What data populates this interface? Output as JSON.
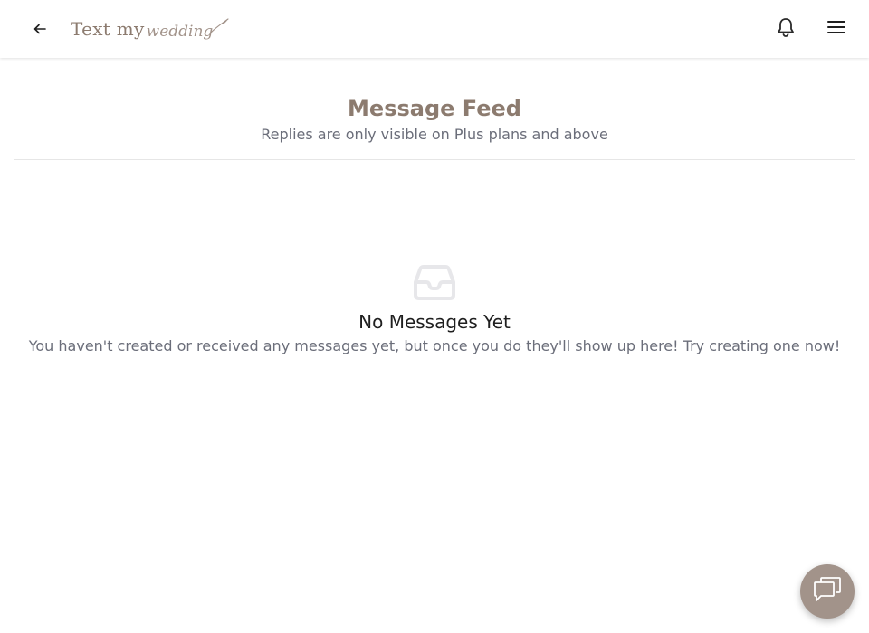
{
  "header": {
    "logo_text": "Text my",
    "logo_script": "wedding",
    "back_icon": "arrow-left-icon",
    "bell_icon": "bell-icon",
    "menu_icon": "hamburger-menu-icon"
  },
  "main": {
    "title": "Message Feed",
    "subtitle": "Replies are only visible on Plus plans and above"
  },
  "empty_state": {
    "icon": "inbox-icon",
    "title": "No Messages Yet",
    "text": "You haven't created or received any messages yet, but once you do they'll show up here! Try creating one now!"
  },
  "chat_widget": {
    "icon": "chat-bubbles-icon"
  },
  "colors": {
    "brand": "#8c7b6f",
    "brand_light": "#a2938a",
    "muted_text": "#6b6e7a",
    "divider": "#e6e6e6"
  }
}
